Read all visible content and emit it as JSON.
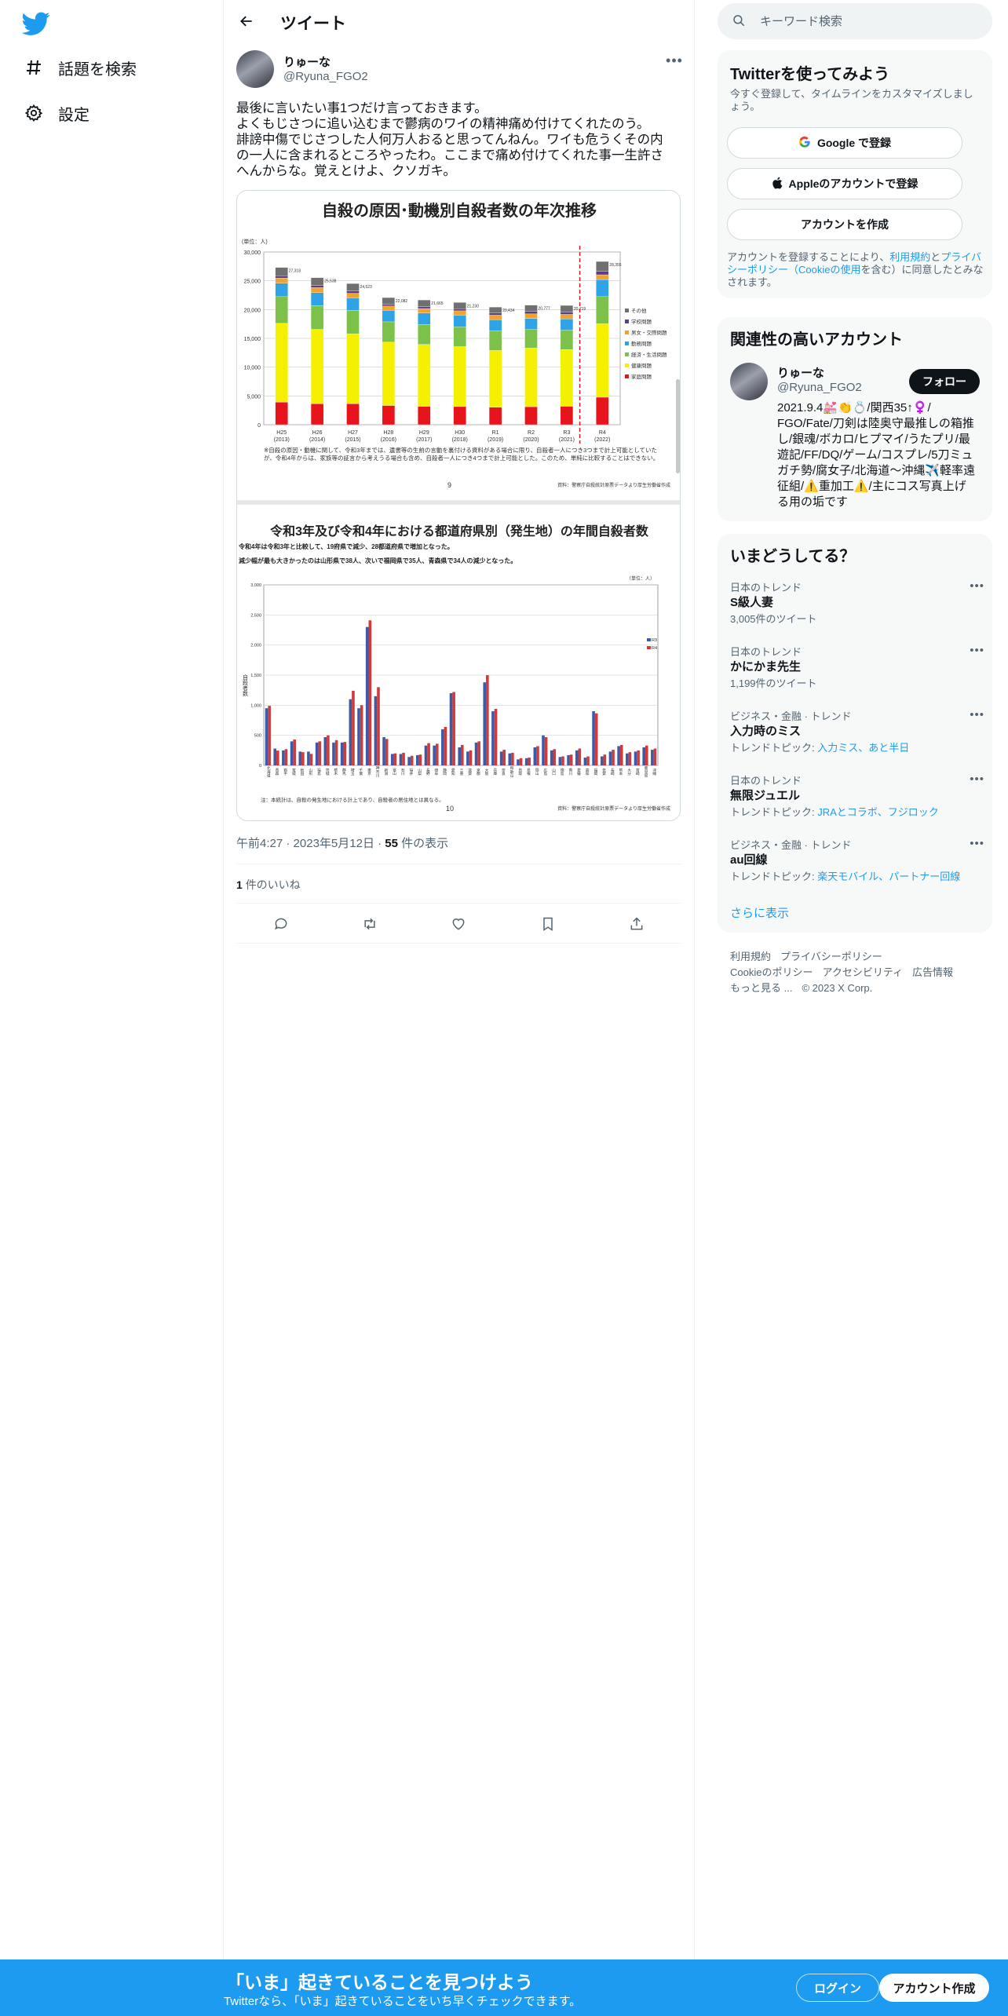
{
  "nav": {
    "logo": "twitter-bird-icon",
    "items": [
      {
        "label": "話題を検索",
        "icon": "hashtag-icon"
      },
      {
        "label": "設定",
        "icon": "gear-icon"
      }
    ]
  },
  "header": {
    "title": "ツイート"
  },
  "tweet": {
    "name": "りゅーな",
    "handle": "@Ryuna_FGO2",
    "text_lines": [
      "最後に言いたい事1つだけ言っておきます。",
      "よくもじさつに追い込むまで鬱病のワイの精神痛め付けてくれたのう。",
      "誹謗中傷でじさつした人何万人おると思ってんねん。ワイも危うくその内",
      "の一人に含まれるところやったわ。ここまで痛め付けてくれた事一生許さ",
      "へんからな。覚えとけよ、クソガキ。"
    ],
    "time": "午前4:27",
    "date": "2023年5月12日",
    "views_count": "55",
    "views_label": "件の表示",
    "likes_count": "1",
    "likes_label": "件のいいね"
  },
  "media": {
    "slide1": {
      "title": "自殺の原因･動機別自殺者数の年次推移",
      "unit": "(単位：人)",
      "note": "※自殺の原因・動機に関して、令和3年までは、遺書等の生前の言動を裏付ける資料がある場合に限り、自殺者一人につき3つまで計上可能としていたが、令和4年からは、家族等の証言から考えうる場合も含め、自殺者一人につき4つまで計上可能とした。このため、単純に比較することはできない。",
      "page": "9",
      "source": "資料：警察庁自殺統計原票データより厚生労働省作成",
      "legend": [
        "その他",
        "学校問題",
        "男女・交際問題",
        "勤務問題",
        "経済・生活問題",
        "健康問題",
        "家庭問題"
      ]
    },
    "slide2": {
      "title": "令和3年及び令和4年における都道府県別（発生地）の年間自殺者数",
      "line1": "令和4年は令和3年と比較して、19府県で減少、28都道府県で増加となった。",
      "line2": "減少幅が最も大きかったのは山形県で38人、次いで福岡県で35人、青森県で34人の減少となった。",
      "unit": "（単位：人）",
      "ylabel": "自殺者数",
      "legend": [
        "R3",
        "R4"
      ],
      "note": "注：本統計は、自殺の発生地における計上であり、自殺者の居住地とは異なる。",
      "page": "10",
      "source": "資料：警察庁自殺統計原票データより厚生労働省作成"
    }
  },
  "chart_data": [
    {
      "type": "bar",
      "title": "自殺の原因･動機別自殺者数の年次推移",
      "ylabel": "(単位：人)",
      "ylim": [
        0,
        30000
      ],
      "categories": [
        "H25\n(2013)",
        "H26\n(2014)",
        "H27\n(2015)",
        "H28\n(2016)",
        "H29\n(2017)",
        "H30\n(2018)",
        "R1\n(2019)",
        "R2\n(2020)",
        "R3\n(2021)",
        "R4\n(2022)"
      ],
      "series": [
        {
          "name": "家庭問題",
          "color": "#e8141b",
          "values": [
            3930,
            3644,
            3641,
            3337,
            3179,
            3147,
            3039,
            3128,
            3200,
            4775
          ]
        },
        {
          "name": "健康問題",
          "color": "#f5f000",
          "values": [
            13680,
            12920,
            12145,
            11014,
            10778,
            10423,
            9861,
            10195,
            9860,
            12774
          ]
        },
        {
          "name": "経済・生活問題",
          "color": "#7cc24a",
          "values": [
            4636,
            4144,
            4082,
            3522,
            3464,
            3432,
            3395,
            3216,
            3376,
            4697
          ]
        },
        {
          "name": "勤務問題",
          "color": "#2ea3e6",
          "values": [
            2323,
            2227,
            2159,
            1978,
            1991,
            2018,
            1949,
            1918,
            1935,
            2968
          ]
        },
        {
          "name": "男女・交際問題",
          "color": "#f0a330",
          "values": [
            912,
            889,
            801,
            764,
            768,
            765,
            784,
            799,
            797,
            828
          ]
        },
        {
          "name": "学校問題",
          "color": "#5a3e8c",
          "values": [
            375,
            372,
            384,
            319,
            329,
            354,
            355,
            400,
            370,
            579
          ]
        },
        {
          "name": "その他",
          "color": "#707070",
          "values": [
            1462,
            1342,
            1311,
            1148,
            1156,
            1091,
            1051,
            1121,
            1181,
            1734
          ]
        }
      ]
    },
    {
      "type": "bar",
      "title": "令和3年及び令和4年における都道府県別（発生地）の年間自殺者数",
      "ylabel": "自殺者数",
      "ylim": [
        0,
        3000
      ],
      "categories": [
        "北海道",
        "青森",
        "岩手",
        "宮城",
        "秋田",
        "山形",
        "福島",
        "茨城",
        "栃木",
        "群馬",
        "埼玉",
        "千葉",
        "東京",
        "神奈川",
        "新潟",
        "富山",
        "石川",
        "福井",
        "山梨",
        "長野",
        "岐阜",
        "静岡",
        "愛知",
        "三重",
        "滋賀",
        "京都",
        "大阪",
        "兵庫",
        "奈良",
        "和歌山",
        "鳥取",
        "島根",
        "岡山",
        "広島",
        "山口",
        "徳島",
        "香川",
        "愛媛",
        "高知",
        "福岡",
        "佐賀",
        "長崎",
        "熊本",
        "大分",
        "宮崎",
        "鹿児島",
        "沖縄"
      ],
      "series": [
        {
          "name": "R3",
          "color": "#3b5ba8",
          "values": [
            950,
            280,
            250,
            400,
            230,
            230,
            380,
            470,
            380,
            380,
            1100,
            950,
            2300,
            1150,
            470,
            190,
            190,
            140,
            170,
            330,
            330,
            600,
            1200,
            300,
            230,
            380,
            1380,
            900,
            230,
            200,
            100,
            120,
            300,
            500,
            250,
            140,
            170,
            250,
            130,
            900,
            150,
            230,
            320,
            200,
            230,
            300,
            260
          ]
        },
        {
          "name": "R4",
          "color": "#d03a3a",
          "values": [
            990,
            246,
            270,
            430,
            220,
            192,
            400,
            500,
            420,
            390,
            1240,
            1000,
            2410,
            1300,
            440,
            200,
            210,
            160,
            180,
            370,
            360,
            640,
            1220,
            340,
            250,
            400,
            1500,
            940,
            260,
            210,
            120,
            130,
            320,
            470,
            270,
            150,
            180,
            280,
            150,
            865,
            180,
            260,
            340,
            220,
            250,
            330,
            280
          ]
        }
      ]
    }
  ],
  "actions": [
    "reply-icon",
    "retweet-icon",
    "like-icon",
    "bookmark-icon",
    "share-icon"
  ],
  "search": {
    "placeholder": "キーワード検索"
  },
  "signup": {
    "title": "Twitterを使ってみよう",
    "subtitle": "今すぐ登録して、タイムラインをカスタマイズしましょう。",
    "google_label": "Google で登録",
    "apple_label": "Appleのアカウントで登録",
    "create_label": "アカウントを作成",
    "legal_pre": "アカウントを登録することにより、",
    "legal_terms": "利用規約",
    "legal_and": "と",
    "legal_privacy": "プライバシーポリシー（Cookieの使用",
    "legal_post": "を含む）に同意したとみなされます。"
  },
  "related": {
    "title": "関連性の高いアカウント",
    "name": "りゅーな",
    "handle": "@Ryuna_FGO2",
    "follow_label": "フォロー",
    "bio_lines": [
      "2021.9.4💒👏💍/関西35↑♀️/",
      "FGO/Fate/刀剣は陸奥守最推しの箱推",
      "し/銀魂/ボカロ/ヒプマイ/うたプリ/最",
      "遊記/FF/DQ/ゲーム/コスプレ/5刀ミュ",
      "ガチ勢/腐女子/北海道～沖縄✈️軽率遠",
      "征組/⚠️重加工⚠️/主にコス写真上げ",
      "る用の垢です"
    ]
  },
  "trends": {
    "title": "いまどうしてる？",
    "items": [
      {
        "category": "日本のトレンド",
        "name": "S級人妻",
        "sub": "3,005件のツイート",
        "sub_is_link": false
      },
      {
        "category": "日本のトレンド",
        "name": "かにかま先生",
        "sub": "1,199件のツイート",
        "sub_is_link": false
      },
      {
        "category": "ビジネス・金融 · トレンド",
        "name": "入力時のミス",
        "sub_prefix": "トレンドトピック: ",
        "sub": "入力ミス、あと半日",
        "sub_is_link": true
      },
      {
        "category": "日本のトレンド",
        "name": "無限ジュエル",
        "sub_prefix": "トレンドトピック: ",
        "sub": "JRAとコラボ、フジロック",
        "sub_is_link": true
      },
      {
        "category": "ビジネス・金融 · トレンド",
        "name": "au回線",
        "sub_prefix": "トレンドトピック: ",
        "sub": "楽天モバイル、パートナー回線",
        "sub_is_link": true
      }
    ],
    "show_more": "さらに表示"
  },
  "footer": {
    "row1": [
      "利用規約",
      "プライバシーポリシー"
    ],
    "row2": [
      "Cookieのポリシー",
      "アクセシビリティ",
      "広告情報"
    ],
    "row3": [
      "もっと見る ...",
      "© 2023 X Corp."
    ]
  },
  "bottombar": {
    "title": "「いま」起きていることを見つけよう",
    "subtitle": "Twitterなら、「いま」起きていることをいち早くチェックできます。",
    "login_label": "ログイン",
    "signup_label": "アカウント作成"
  },
  "colors": {
    "accent": "#1d9bf0",
    "text": "#0f1419",
    "muted": "#536471",
    "border": "#eff3f4"
  }
}
